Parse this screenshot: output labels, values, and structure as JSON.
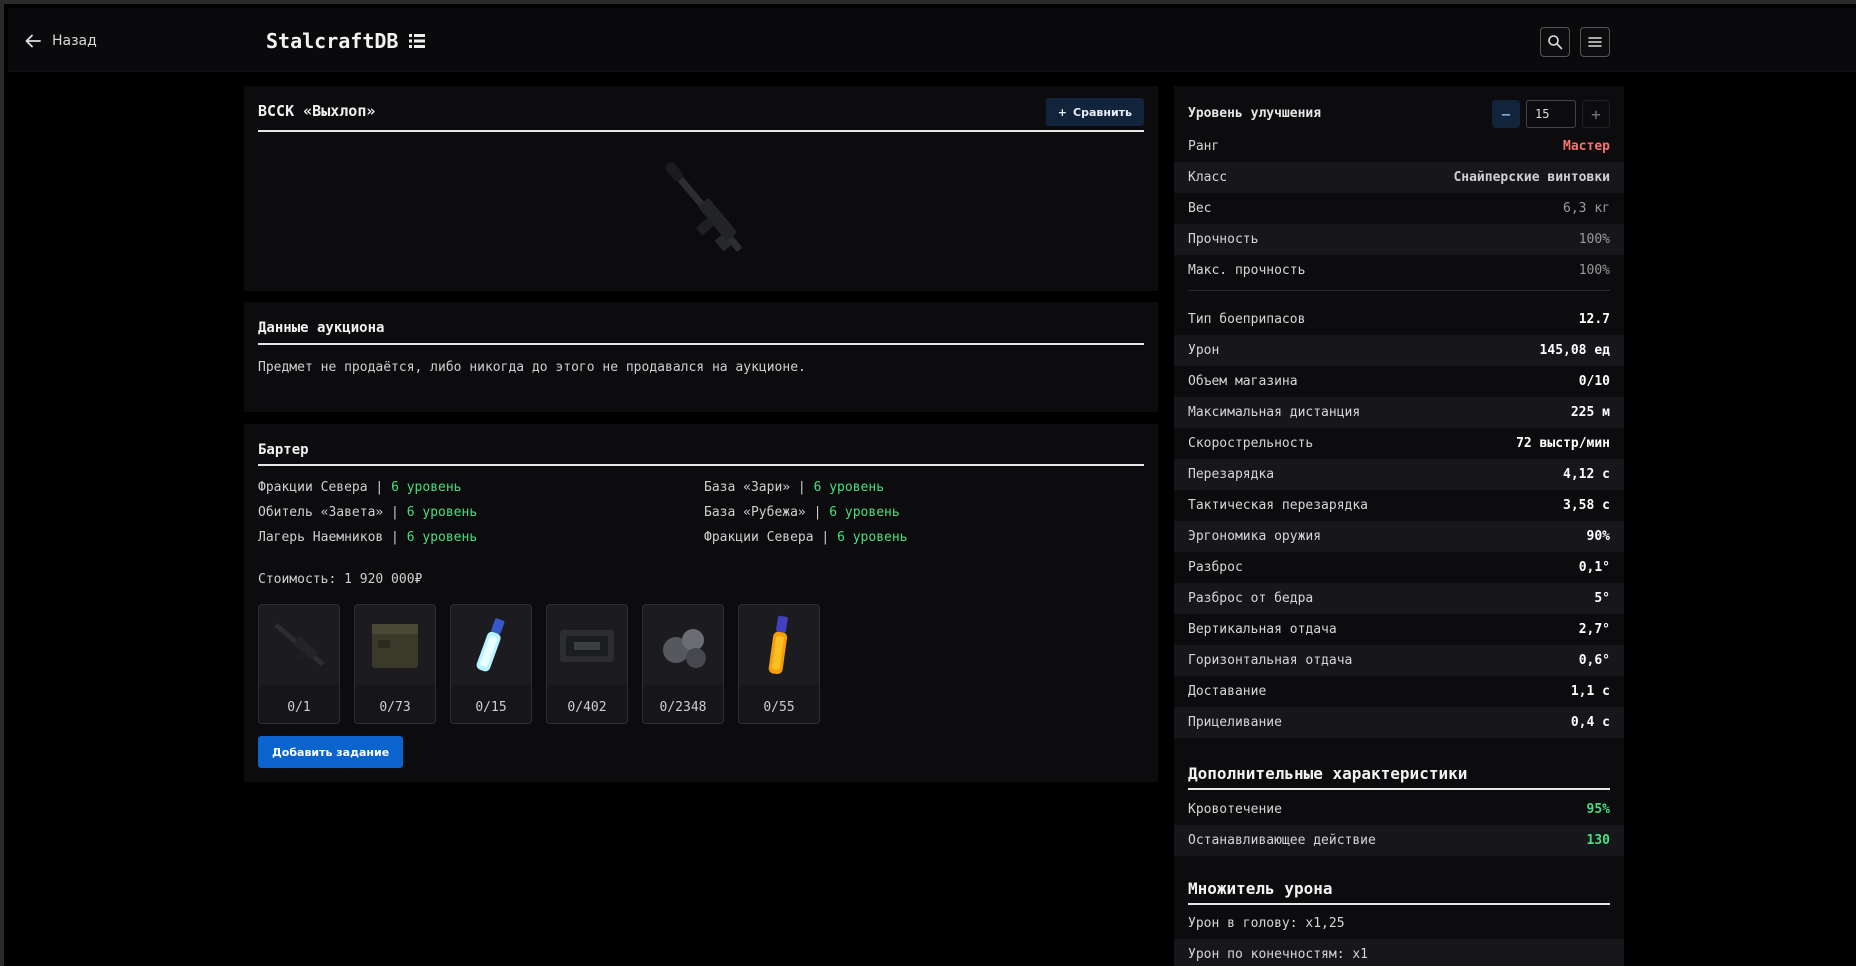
{
  "header": {
    "back_label": "Назад",
    "brand": "StalcraftDB"
  },
  "item": {
    "title": "ВССК «Выхлоп»",
    "compare_label": "Сравнить"
  },
  "auction": {
    "title": "Данные аукциона",
    "text": "Предмет не продаётся, либо никогда до этого не продавался на аукционе."
  },
  "barter": {
    "title": "Бартер",
    "sep": " | ",
    "entries": [
      {
        "name": "Фракции Севера",
        "level": "6 уровень"
      },
      {
        "name": "База «Зари»",
        "level": "6 уровень"
      },
      {
        "name": "Обитель «Завета»",
        "level": "6 уровень"
      },
      {
        "name": "База «Рубежа»",
        "level": "6 уровень"
      },
      {
        "name": "Лагерь Наемников",
        "level": "6 уровень"
      },
      {
        "name": "Фракции Севера",
        "level": "6 уровень"
      }
    ],
    "cost": "Стоимость: 1 920 000₽",
    "items": [
      {
        "count": "0/1",
        "icon": "rifle-icon"
      },
      {
        "count": "0/73",
        "icon": "crate-icon"
      },
      {
        "count": "0/15",
        "icon": "vial-blue-icon"
      },
      {
        "count": "0/402",
        "icon": "case-icon"
      },
      {
        "count": "0/2348",
        "icon": "spheres-icon"
      },
      {
        "count": "0/55",
        "icon": "vial-orange-icon"
      }
    ],
    "add_task_label": "Добавить задание"
  },
  "stats": {
    "upgrade_label": "Уровень улучшения",
    "upgrade_value": "15",
    "rows_top": [
      {
        "k": "Ранг",
        "v": "Мастер",
        "style": "rank"
      },
      {
        "k": "Класс",
        "v": "Снайперские винтовки",
        "style": "cls"
      },
      {
        "k": "Вес",
        "v": "6,3 кг",
        "style": "dim"
      },
      {
        "k": "Прочность",
        "v": "100%",
        "style": "dim"
      },
      {
        "k": "Макс. прочность",
        "v": "100%",
        "style": "dim"
      }
    ],
    "rows_main": [
      {
        "k": "Тип боеприпасов",
        "v": "12.7"
      },
      {
        "k": "Урон",
        "v": "145,08 ед"
      },
      {
        "k": "Объем магазина",
        "v": "0/10"
      },
      {
        "k": "Максимальная дистанция",
        "v": "225 м"
      },
      {
        "k": "Скорострельность",
        "v": "72 выстр/мин"
      },
      {
        "k": "Перезарядка",
        "v": "4,12 с"
      },
      {
        "k": "Тактическая перезарядка",
        "v": "3,58 с"
      },
      {
        "k": "Эргономика оружия",
        "v": "90%"
      },
      {
        "k": "Разброс",
        "v": "0,1°"
      },
      {
        "k": "Разброс от бедра",
        "v": "5°"
      },
      {
        "k": "Вертикальная отдача",
        "v": "2,7°"
      },
      {
        "k": "Горизонтальная отдача",
        "v": "0,6°"
      },
      {
        "k": "Доставание",
        "v": "1,1 с"
      },
      {
        "k": "Прицеливание",
        "v": "0,4 с"
      }
    ],
    "extra_title": "Дополнительные характеристики",
    "extra_rows": [
      {
        "k": "Кровотечение",
        "v": "95%"
      },
      {
        "k": "Останавливающее действие",
        "v": "130"
      }
    ],
    "mult_title": "Множитель урона",
    "mult_rows": [
      "Урон в голову: x1,25",
      "Урон по конечностям: x1"
    ]
  },
  "colors": {
    "accent_blue": "#0b63ce",
    "level_green": "#4ade80",
    "rank_red": "#f87171"
  }
}
